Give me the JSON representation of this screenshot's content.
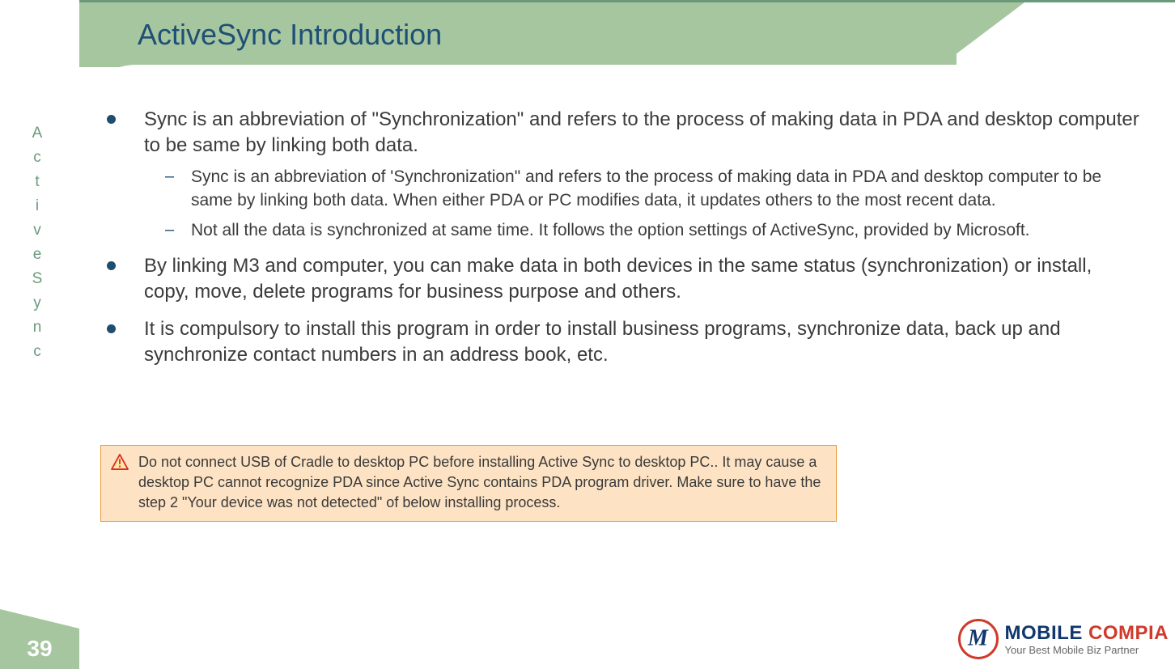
{
  "slide": {
    "title": "ActiveSync Introduction",
    "page_number": "39",
    "sidebar_label_chars": [
      "A",
      "c",
      "t",
      "i",
      "v",
      "e",
      "S",
      "y",
      "n",
      "c"
    ]
  },
  "bullets": {
    "b1": "Sync is an abbreviation of \"Synchronization\" and refers to the process of making data in PDA and desktop computer to be same by linking both data.",
    "b1_sub1": "Sync is an abbreviation of 'Synchronization\" and refers to the process of making data in PDA and desktop computer to be same by linking both data. When either PDA or PC modifies data, it updates others to the most recent data.",
    "b1_sub2": "Not all the data is synchronized at same time. It follows the option settings of ActiveSync, provided by Microsoft.",
    "b2": "By linking M3 and computer, you can make data in both devices in the same status (synchronization) or install, copy, move, delete programs for business purpose and others.",
    "b3": "It is compulsory to install this program in order to install business programs, synchronize data, back up and synchronize contact numbers in an address book, etc."
  },
  "warning": {
    "text": "Do not connect USB of Cradle to desktop PC before installing Active Sync to desktop PC.. It may cause a desktop PC cannot recognize PDA since Active Sync contains PDA program driver. Make sure to have the step 2 \"Your device was not detected\" of below installing process."
  },
  "logo": {
    "word1": "MOBILE ",
    "word2": "COMPIA",
    "tagline": "Your Best Mobile Biz Partner"
  },
  "colors": {
    "accent_green": "#a5c69e",
    "accent_dark_green": "#6a9a7a",
    "title_blue": "#1f4f75",
    "bullet_blue": "#1f4d70",
    "warn_bg": "#fde3c4",
    "warn_border": "#e79a3c",
    "logo_blue": "#11376d",
    "logo_red": "#d03a2b"
  }
}
